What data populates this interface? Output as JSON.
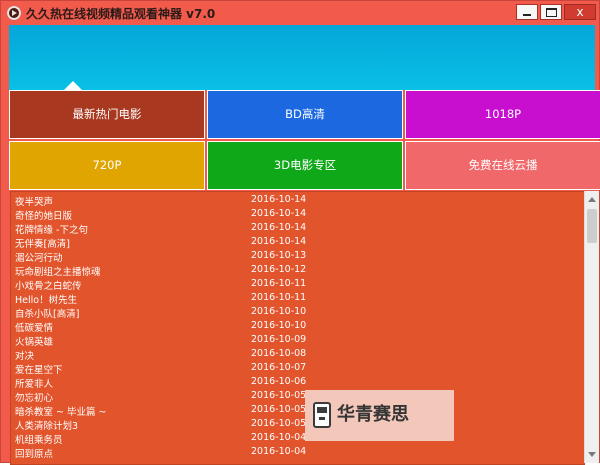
{
  "window": {
    "title": "久久热在线视频精品观看神器 v7.0",
    "buttons": {
      "minimize": "",
      "maximize": "",
      "close": "x"
    },
    "colors": {
      "titlebar": "#f25a4c",
      "banner": "#09c0e6",
      "list_bg": "#e2542c"
    }
  },
  "tiles": [
    {
      "label": "最新热门电影",
      "color": "#a8381f"
    },
    {
      "label": "BD高清",
      "color": "#1b68e0"
    },
    {
      "label": "1018P",
      "color": "#c80fd0"
    },
    {
      "label": "720P",
      "color": "#e0a500"
    },
    {
      "label": "3D电影专区",
      "color": "#0fa818"
    },
    {
      "label": "免费在线云播",
      "color": "#f0686a"
    }
  ],
  "list": [
    {
      "name": "夜半哭声",
      "date": "2016-10-14"
    },
    {
      "name": "奇怪的她日版",
      "date": "2016-10-14"
    },
    {
      "name": "花牌情缘 -下之句",
      "date": "2016-10-14"
    },
    {
      "name": "无伴奏[高清]",
      "date": "2016-10-14"
    },
    {
      "name": "湄公河行动",
      "date": "2016-10-13"
    },
    {
      "name": "玩命剧组之主播惊魂",
      "date": "2016-10-12"
    },
    {
      "name": "小戏骨之白蛇传",
      "date": "2016-10-11"
    },
    {
      "name": "Hello！树先生",
      "date": "2016-10-11"
    },
    {
      "name": "自杀小队[高清]",
      "date": "2016-10-10"
    },
    {
      "name": "低碳爱情",
      "date": "2016-10-10"
    },
    {
      "name": "火锅英雄",
      "date": "2016-10-09"
    },
    {
      "name": "对决",
      "date": "2016-10-08"
    },
    {
      "name": "爱在星空下",
      "date": "2016-10-07"
    },
    {
      "name": "所爱非人",
      "date": "2016-10-06"
    },
    {
      "name": "勿忘初心",
      "date": "2016-10-05"
    },
    {
      "name": "暗杀教室 ~ 毕业篇 ~",
      "date": "2016-10-05"
    },
    {
      "name": "人类清除计划3",
      "date": "2016-10-05"
    },
    {
      "name": "机组乘务员",
      "date": "2016-10-04"
    },
    {
      "name": "回到原点",
      "date": "2016-10-04"
    }
  ],
  "watermark": {
    "text": "华青赛思",
    "icon": "phone-icon"
  }
}
